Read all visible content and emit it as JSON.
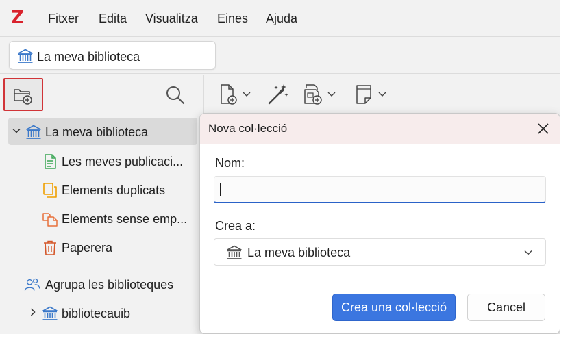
{
  "app": {
    "logo": "Z"
  },
  "menu": {
    "items": [
      {
        "label": "Fitxer"
      },
      {
        "label": "Edita"
      },
      {
        "label": "Visualitza"
      },
      {
        "label": "Eines"
      },
      {
        "label": "Ajuda"
      }
    ]
  },
  "tab": {
    "label": "La meva biblioteca",
    "icon": "library-icon"
  },
  "left_toolbar": {
    "new_collection_icon": "new-collection-icon",
    "search_icon": "search-icon"
  },
  "tree": {
    "items": [
      {
        "label": "La meva biblioteca",
        "icon": "library-icon",
        "expanded": true,
        "selected": true
      },
      {
        "label": "Les meves publicaci...",
        "icon": "publications-icon"
      },
      {
        "label": "Elements duplicats",
        "icon": "duplicates-icon"
      },
      {
        "label": "Elements sense emp...",
        "icon": "unfiled-icon"
      },
      {
        "label": "Paperera",
        "icon": "trash-icon"
      },
      {
        "label": "Agrupa les biblioteques",
        "icon": "groups-icon"
      },
      {
        "label": "bibliotecauib",
        "icon": "library-icon",
        "expanded": false
      }
    ]
  },
  "items_toolbar": {
    "buttons": [
      "new-item-icon",
      "magic-wand-icon",
      "add-attachment-icon",
      "new-note-icon"
    ]
  },
  "dialog": {
    "title": "Nova col·lecció",
    "name_label": "Nom:",
    "name_value": "",
    "create_in_label": "Crea a:",
    "create_in_value": "La meva biblioteca",
    "create_button": "Crea una col·lecció",
    "cancel_button": "Cancel"
  },
  "colors": {
    "accent": "#3b76e0",
    "logo": "#d9232d",
    "library_icon": "#3a78c9",
    "publications_icon": "#3aa655",
    "duplicates_icon": "#f0a000",
    "unfiled_icon": "#e8703a",
    "trash_icon": "#d4572a",
    "highlight_border": "#d13438"
  }
}
